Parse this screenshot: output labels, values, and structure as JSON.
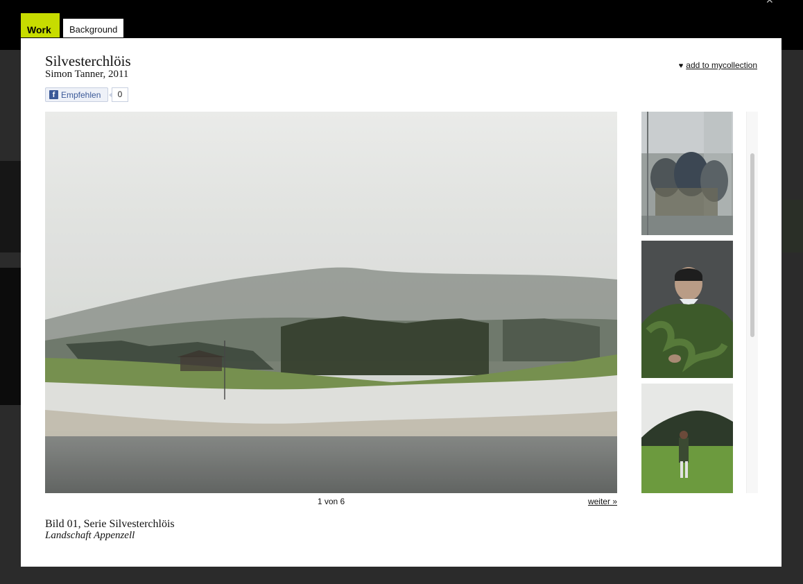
{
  "tabs": [
    {
      "label": "Work",
      "active": true
    },
    {
      "label": "Background",
      "active": false
    }
  ],
  "artwork": {
    "title": "Silvesterchlöis",
    "artist_year": "Simon Tanner, 2011"
  },
  "collection": {
    "label": "add to mycollection",
    "icon": "heart-icon"
  },
  "facebook": {
    "like_label": "Empfehlen",
    "count": "0",
    "icon": "facebook-icon"
  },
  "pager": {
    "counter": "1 von 6",
    "next_label": "weiter »"
  },
  "caption": {
    "line1": "Bild 01, Serie Silvesterchlöis",
    "line2": "Landschaft Appenzell"
  },
  "colors": {
    "accent": "#c7dc00",
    "background": "#2b2b2b",
    "modal": "#ffffff",
    "facebook": "#3b5998"
  }
}
